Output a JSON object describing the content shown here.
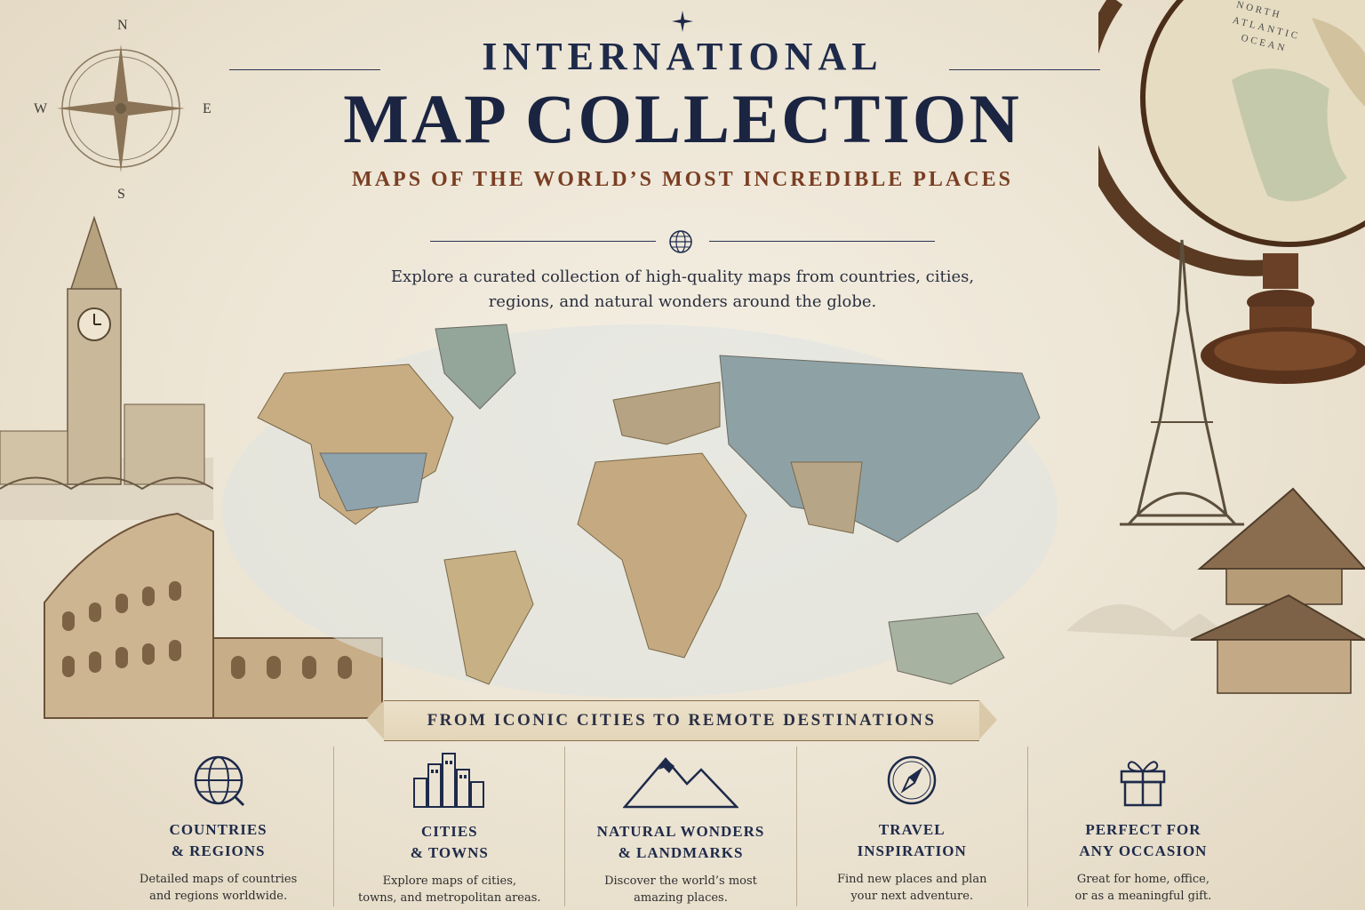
{
  "header": {
    "title_top": "INTERNATIONAL",
    "title_main": "MAP COLLECTION",
    "subtitle": "MAPS OF THE WORLD’S MOST INCREDIBLE PLACES",
    "description_line1": "Explore a curated collection of high-quality maps from countries, cities,",
    "description_line2": "regions, and natural wonders around the globe."
  },
  "compass": {
    "n": "N",
    "s": "S",
    "e": "E",
    "w": "W"
  },
  "globe": {
    "label_line1": "NORTH",
    "label_line2": "ATLANTIC",
    "label_line3": "OCEAN"
  },
  "banner": {
    "text": "FROM ICONIC CITIES TO REMOTE DESTINATIONS"
  },
  "features": [
    {
      "icon": "globe-icon",
      "title1": "COUNTRIES",
      "title2": "& REGIONS",
      "desc1": "Detailed maps of countries",
      "desc2": "and regions worldwide."
    },
    {
      "icon": "city-buildings-icon",
      "title1": "CITIES",
      "title2": "& TOWNS",
      "desc1": "Explore maps of cities,",
      "desc2": "towns, and metropolitan areas."
    },
    {
      "icon": "mountains-icon",
      "title1": "NATURAL WONDERS",
      "title2": "& LANDMARKS",
      "desc1": "Discover the world’s most",
      "desc2": "amazing places."
    },
    {
      "icon": "compass-icon",
      "title1": "TRAVEL",
      "title2": "INSPIRATION",
      "desc1": "Find new places and plan",
      "desc2": "your next adventure."
    },
    {
      "icon": "gift-icon",
      "title1": "PERFECT FOR",
      "title2": "ANY OCCASION",
      "desc1": "Great for home, office,",
      "desc2": "or as a meaningful gift."
    }
  ],
  "colors": {
    "navy": "#1b2542",
    "rust": "#7a3e22",
    "parchment": "#ece4d3"
  }
}
